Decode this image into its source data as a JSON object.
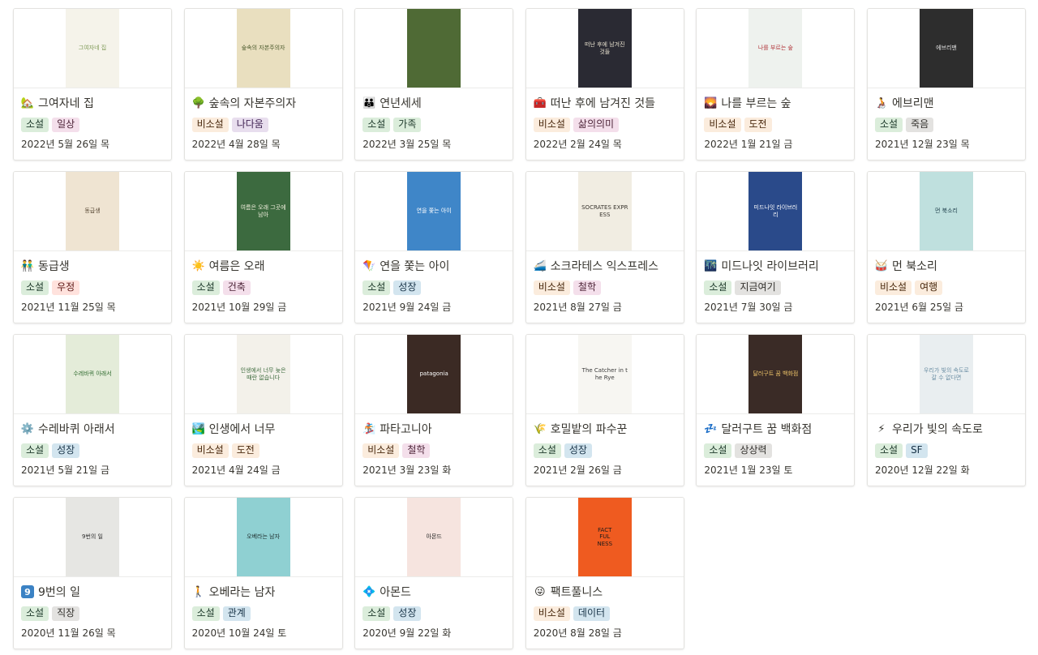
{
  "tag_colors": {
    "소설": {
      "bg": "#dbeddb",
      "fg": "#1c3829"
    },
    "비소설": {
      "bg": "#fbecdd",
      "fg": "#49290e"
    },
    "일상": {
      "bg": "#f4dfeb",
      "fg": "#4c2337"
    },
    "나다움": {
      "bg": "#e8deee",
      "fg": "#412454"
    },
    "가족": {
      "bg": "#dbeddb",
      "fg": "#1c3829"
    },
    "삶의의미": {
      "bg": "#f4dfeb",
      "fg": "#4c2337"
    },
    "도전": {
      "bg": "#fbecdd",
      "fg": "#49290e"
    },
    "죽음": {
      "bg": "#e3e2e0",
      "fg": "#32302c"
    },
    "우정": {
      "bg": "#ffe2dd",
      "fg": "#5d1715"
    },
    "건축": {
      "bg": "#f4dfeb",
      "fg": "#4c2337"
    },
    "성장": {
      "bg": "#d3e5ef",
      "fg": "#183347"
    },
    "철학": {
      "bg": "#f4dfeb",
      "fg": "#4c2337"
    },
    "지금여기": {
      "bg": "#e3e2e0",
      "fg": "#32302c"
    },
    "여행": {
      "bg": "#fbecdd",
      "fg": "#49290e"
    },
    "상상력": {
      "bg": "#e3e2e0",
      "fg": "#32302c"
    },
    "SF": {
      "bg": "#d3e5ef",
      "fg": "#183347"
    },
    "직장": {
      "bg": "#e3e2e0",
      "fg": "#32302c"
    },
    "관계": {
      "bg": "#d3e5ef",
      "fg": "#183347"
    },
    "데이터": {
      "bg": "#d3e5ef",
      "fg": "#183347"
    }
  },
  "books": [
    {
      "title": "그여자네 집",
      "emoji": "🏡",
      "icon": "house-icon",
      "tags": [
        "소설",
        "일상"
      ],
      "date": "2022년 5월 26일 목",
      "cover_bg": "#f5f3ea",
      "cover_fg": "#7f9a57",
      "cover_text": "그여자네 집"
    },
    {
      "title": "숲속의 자본주의자",
      "emoji": "🌳",
      "icon": "tree-icon",
      "tags": [
        "비소설",
        "나다움"
      ],
      "date": "2022년 4월 28일 목",
      "cover_bg": "#e9dfbf",
      "cover_fg": "#4b5a2c",
      "cover_text": "숲속의 자본주의자"
    },
    {
      "title": "연년세세",
      "emoji": "👪",
      "icon": "family-icon",
      "tags": [
        "소설",
        "가족"
      ],
      "date": "2022년 3월 25일 목",
      "cover_bg": "#4f6a35",
      "cover_fg": "#e7e3c5",
      "cover_text": ""
    },
    {
      "title": "떠난 후에 남겨진 것들",
      "emoji": "🧰",
      "icon": "toolbox-icon",
      "tags": [
        "비소설",
        "삶의의미"
      ],
      "date": "2022년 2월 24일 목",
      "cover_bg": "#2a2a33",
      "cover_fg": "#e9e2cf",
      "cover_text": "떠난 후에 남겨진 것들"
    },
    {
      "title": "나를 부르는 숲",
      "emoji": "🌄",
      "icon": "sunrise-icon",
      "tags": [
        "비소설",
        "도전"
      ],
      "date": "2022년 1월 21일 금",
      "cover_bg": "#eef2ee",
      "cover_fg": "#b1353a",
      "cover_text": "나를 부르는 숲"
    },
    {
      "title": "에브리맨",
      "emoji": "🧑‍🦽",
      "icon": "wheelchair-icon",
      "tags": [
        "소설",
        "죽음"
      ],
      "date": "2021년 12월 23일 목",
      "cover_bg": "#2d2d2d",
      "cover_fg": "#e6e6e6",
      "cover_text": "에브리맨"
    },
    {
      "title": "동급생",
      "emoji": "👬",
      "icon": "two-men-icon",
      "tags": [
        "소설",
        "우정"
      ],
      "date": "2021년 11월 25일 목",
      "cover_bg": "#efe4d2",
      "cover_fg": "#5a4a36",
      "cover_text": "동급생"
    },
    {
      "title": "여름은 오래",
      "emoji": "☀️",
      "icon": "sun-icon",
      "tags": [
        "소설",
        "건축"
      ],
      "date": "2021년 10월 29일 금",
      "cover_bg": "#3c6a3f",
      "cover_fg": "#f2f0de",
      "cover_text": "여름은 오래 그곳에 남아"
    },
    {
      "title": "연을 쫓는 아이",
      "emoji": "🪁",
      "icon": "kite-icon",
      "tags": [
        "소설",
        "성장"
      ],
      "date": "2021년 9월 24일 금",
      "cover_bg": "#3f86c8",
      "cover_fg": "#ffffff",
      "cover_text": "연을 쫓는 아이"
    },
    {
      "title": "소크라테스 익스프레스",
      "emoji": "🚄",
      "icon": "train-icon",
      "tags": [
        "비소설",
        "철학"
      ],
      "date": "2021년 8월 27일 금",
      "cover_bg": "#f1ede2",
      "cover_fg": "#3a3630",
      "cover_text": "SOCRATES EXPRESS"
    },
    {
      "title": "미드나잇 라이브러리",
      "emoji": "🌃",
      "icon": "city-night-icon",
      "tags": [
        "소설",
        "지금여기"
      ],
      "date": "2021년 7월 30일 금",
      "cover_bg": "#2a4a8a",
      "cover_fg": "#ffffff",
      "cover_text": "미드나잇 라이브러리"
    },
    {
      "title": "먼 북소리",
      "emoji": "🥁",
      "icon": "drum-icon",
      "tags": [
        "비소설",
        "여행"
      ],
      "date": "2021년 6월 25일 금",
      "cover_bg": "#bfe0de",
      "cover_fg": "#1f3f4c",
      "cover_text": "먼 북소리"
    },
    {
      "title": "수레바퀴 아래서",
      "emoji": "⚙️",
      "icon": "gear-icon",
      "tags": [
        "소설",
        "성장"
      ],
      "date": "2021년 5월 21일 금",
      "cover_bg": "#e4ecd9",
      "cover_fg": "#2f6b2f",
      "cover_text": "수레바퀴 아래서"
    },
    {
      "title": "인생에서 너무",
      "emoji": "🏞️",
      "icon": "landscape-icon",
      "tags": [
        "비소설",
        "도전"
      ],
      "date": "2021년 4월 24일 금",
      "cover_bg": "#f3f1ea",
      "cover_fg": "#3d6b3d",
      "cover_text": "인생에서 너무 늦은 때란 없습니다"
    },
    {
      "title": "파타고니아",
      "emoji": "🏂",
      "icon": "snowboarder-icon",
      "tags": [
        "비소설",
        "철학"
      ],
      "date": "2021년 3월 23일 화",
      "cover_bg": "#3b2a24",
      "cover_fg": "#ffffff",
      "cover_text": "patagonia"
    },
    {
      "title": "호밀밭의 파수꾼",
      "emoji": "🌾",
      "icon": "rice-icon",
      "tags": [
        "소설",
        "성장"
      ],
      "date": "2021년 2월 26일 금",
      "cover_bg": "#f7f6f2",
      "cover_fg": "#3a3a3a",
      "cover_text": "The Catcher in the Rye"
    },
    {
      "title": "달러구트 꿈 백화점",
      "emoji": "💤",
      "icon": "zzz-icon",
      "tags": [
        "소설",
        "상상력"
      ],
      "date": "2021년 1월 23일 토",
      "cover_bg": "#3a2b26",
      "cover_fg": "#f0c66a",
      "cover_text": "달러구트 꿈 백화점"
    },
    {
      "title": "우리가 빛의 속도로",
      "emoji": "⚡",
      "icon": "lightning-icon",
      "tags": [
        "소설",
        "SF"
      ],
      "date": "2020년 12월 22일 화",
      "cover_bg": "#e9eef0",
      "cover_fg": "#6b8ea3",
      "cover_text": "우리가 빛의 속도로 갈 수 없다면"
    },
    {
      "title": "9번의 일",
      "emoji": "9",
      "icon": "nine-icon",
      "tags": [
        "소설",
        "직장"
      ],
      "date": "2020년 11월 26일 목",
      "cover_bg": "#e6e6e3",
      "cover_fg": "#2b2b2b",
      "cover_text": "9번의 일"
    },
    {
      "title": "오베라는 남자",
      "emoji": "🚶",
      "icon": "walking-man-icon",
      "tags": [
        "소설",
        "관계"
      ],
      "date": "2020년 10월 24일 토",
      "cover_bg": "#8fd0d2",
      "cover_fg": "#1f2f2f",
      "cover_text": "오베라는 남자"
    },
    {
      "title": "아몬드",
      "emoji": "💠",
      "icon": "diamond-icon",
      "tags": [
        "소설",
        "성장"
      ],
      "date": "2020년 9월 22일 화",
      "cover_bg": "#f6e4df",
      "cover_fg": "#222222",
      "cover_text": "아몬드"
    },
    {
      "title": "팩트풀니스",
      "emoji": "😜",
      "icon": "winking-face-icon",
      "tags": [
        "비소설",
        "데이터"
      ],
      "date": "2020년 8월 28일 금",
      "cover_bg": "#ef5b20",
      "cover_fg": "#1a1a1a",
      "cover_text": "FACT\nFUL\nNESS"
    }
  ]
}
